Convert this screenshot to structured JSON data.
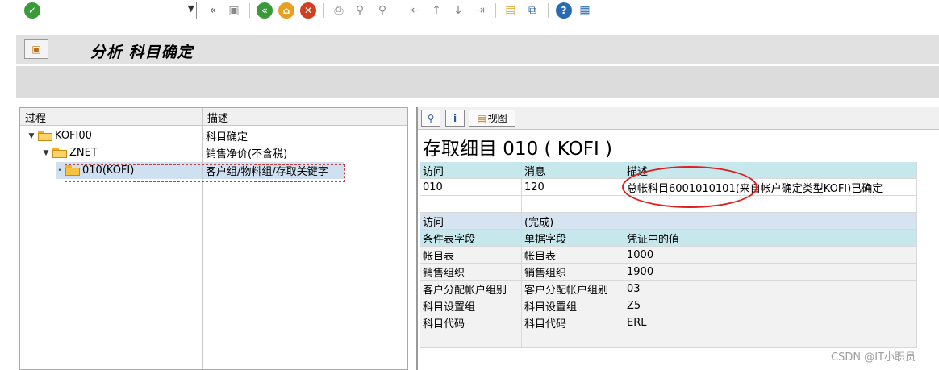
{
  "toolbar": {
    "command_value": "",
    "items": [
      "enter-icon",
      "save-icon",
      "back-icon",
      "exit-icon",
      "cancel-icon",
      "print-icon",
      "find-icon",
      "find-next-icon",
      "first-page-icon",
      "previous-page-icon",
      "next-page-icon",
      "last-page-icon",
      "new-session-icon",
      "shortcut-icon",
      "help-icon",
      "customize-layout-icon"
    ]
  },
  "title": {
    "text": "分析 科目确定"
  },
  "tree": {
    "columns": [
      "过程",
      "描述"
    ],
    "rows": [
      {
        "node": "KOFI00",
        "desc": "科目确定",
        "level": 0,
        "expanded": true
      },
      {
        "node": "ZNET",
        "desc": "销售净价(不含税)",
        "level": 1,
        "expanded": true
      },
      {
        "node": "010(KOFI)",
        "desc": "客户组/物料组/存取关键字",
        "level": 2,
        "selected": true
      }
    ]
  },
  "detail": {
    "toolbar": {
      "view_label": "视图"
    },
    "heading": "存取细目 010 ( KOFI )",
    "message_header": [
      "访问",
      "消息",
      "描述"
    ],
    "message_row": [
      "010",
      "120",
      "总帐科目6001010101(来自帐户确定类型KOFI)已确定"
    ],
    "access_header": [
      "访问",
      "(完成)",
      ""
    ],
    "field_header": [
      "条件表字段",
      "单据字段",
      "凭证中的值"
    ],
    "field_rows": [
      [
        "帐目表",
        "帐目表",
        "1000"
      ],
      [
        "销售组织",
        "销售组织",
        "1900"
      ],
      [
        "客户分配帐户组别",
        "客户分配帐户组别",
        "03"
      ],
      [
        "科目设置组",
        "科目设置组",
        "Z5"
      ],
      [
        "科目代码",
        "科目代码",
        "ERL"
      ]
    ]
  },
  "watermark": "CSDN @IT小职员",
  "colors": {
    "teal_header": "#c6e8ec",
    "blue_header": "#d6e3f1",
    "selection": "#cfe0f0",
    "annotation": "#e02020"
  }
}
